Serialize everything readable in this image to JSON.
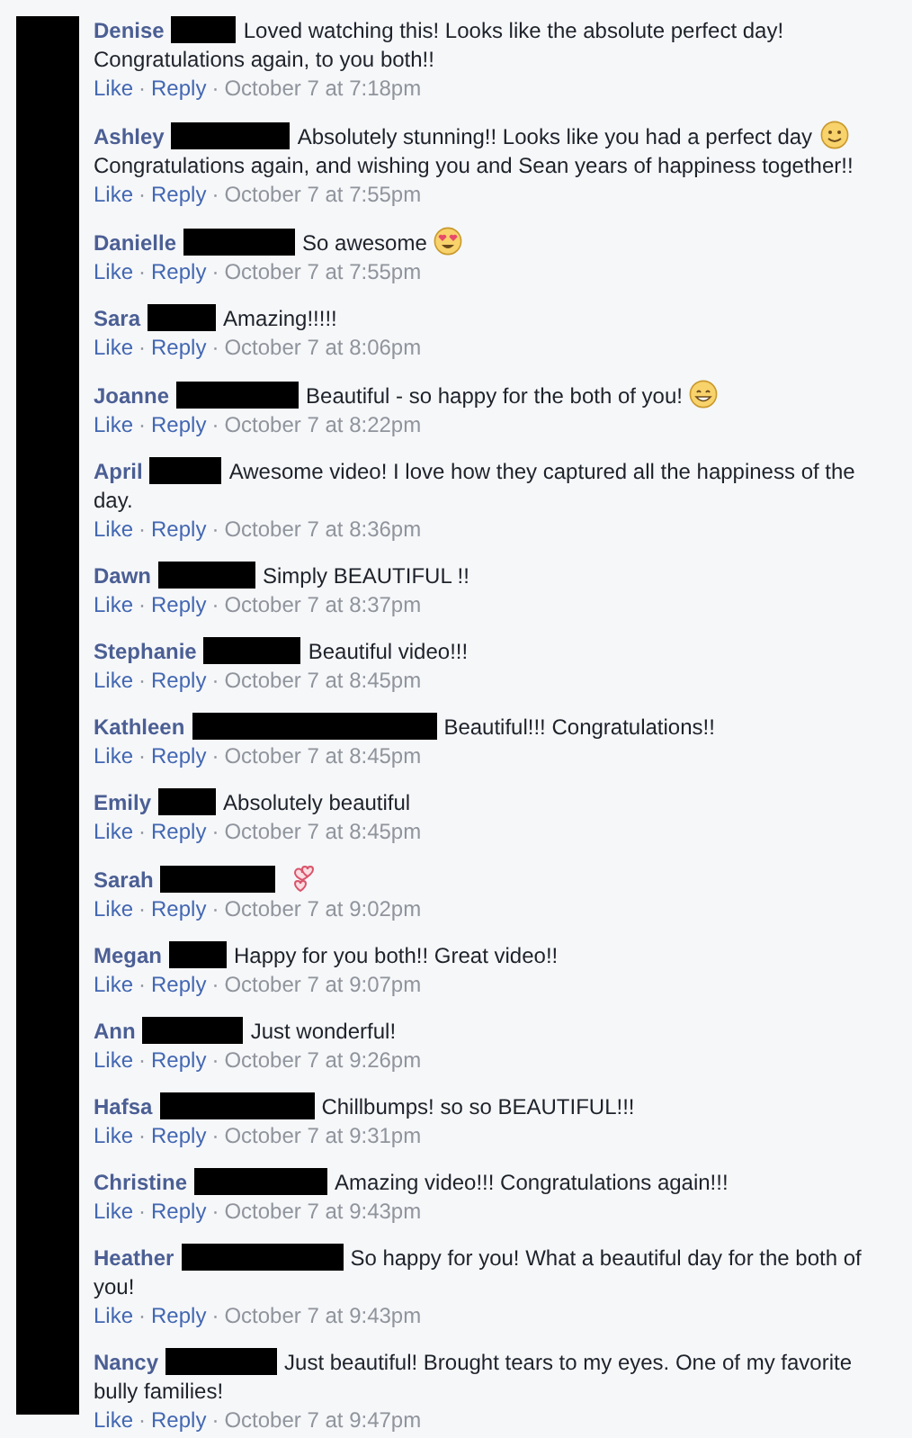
{
  "comments": [
    {
      "kind": "plain",
      "name": "Denise",
      "text": "Loved watching this! Looks like the absolute perfect day!",
      "text_after": "Congratulations again, to you both!!",
      "like": "Like",
      "dot_1": "·",
      "reply": "Reply",
      "dot_2": "·",
      "time": "October 7 at 7:18pm"
    },
    {
      "kind": "smile",
      "name": "Ashley",
      "text": "Absolutely stunning!! Looks like you had a perfect day",
      "text_after": "Congratulations again, and wishing you and Sean years of happiness together!!",
      "like": "Like",
      "dot_1": "·",
      "reply": "Reply",
      "dot_2": "·",
      "time": "October 7 at 7:55pm"
    },
    {
      "kind": "hearteyes",
      "name": "Danielle",
      "text": "So awesome",
      "like": "Like",
      "dot_1": "·",
      "reply": "Reply",
      "dot_2": "·",
      "time": "October 7 at 7:55pm"
    },
    {
      "kind": "plain",
      "name": "Sara",
      "text": "Amazing!!!!!",
      "like": "Like",
      "dot_1": "·",
      "reply": "Reply",
      "dot_2": "·",
      "time": "October 7 at 8:06pm"
    },
    {
      "kind": "grin",
      "name": "Joanne",
      "text": "Beautiful - so happy for the both of you!",
      "like": "Like",
      "dot_1": "·",
      "reply": "Reply",
      "dot_2": "·",
      "time": "October 7 at 8:22pm"
    },
    {
      "kind": "plain",
      "name": "April",
      "text": "Awesome video! I love how they captured all the happiness of the",
      "text_after": "day.",
      "like": "Like",
      "dot_1": "·",
      "reply": "Reply",
      "dot_2": "·",
      "time": "October 7 at 8:36pm"
    },
    {
      "kind": "plain",
      "name": "Dawn",
      "text": "Simply BEAUTIFUL !!",
      "like": "Like",
      "dot_1": "·",
      "reply": "Reply",
      "dot_2": "·",
      "time": "October 7 at 8:37pm"
    },
    {
      "kind": "plain",
      "name": "Stephanie",
      "text": "Beautiful video!!!",
      "like": "Like",
      "dot_1": "·",
      "reply": "Reply",
      "dot_2": "·",
      "time": "October 7 at 8:45pm"
    },
    {
      "kind": "plain",
      "name": "Kathleen",
      "text": "Beautiful!!! Congratulations!!",
      "like": "Like",
      "dot_1": "·",
      "reply": "Reply",
      "dot_2": "·",
      "time": "October 7 at 8:45pm"
    },
    {
      "kind": "plain",
      "name": "Emily",
      "text": "Absolutely beautiful",
      "like": "Like",
      "dot_1": "·",
      "reply": "Reply",
      "dot_2": "·",
      "time": "October 7 at 8:45pm"
    },
    {
      "kind": "hearts",
      "name": "Sarah",
      "like": "Like",
      "dot_1": "·",
      "reply": "Reply",
      "dot_2": "·",
      "time": "October 7 at 9:02pm"
    },
    {
      "kind": "plain",
      "name": "Megan",
      "text": "Happy for you both!! Great video!!",
      "like": "Like",
      "dot_1": "·",
      "reply": "Reply",
      "dot_2": "·",
      "time": "October 7 at 9:07pm"
    },
    {
      "kind": "plain",
      "name": "Ann",
      "text": "Just wonderful!",
      "like": "Like",
      "dot_1": "·",
      "reply": "Reply",
      "dot_2": "·",
      "time": "October 7 at 9:26pm"
    },
    {
      "kind": "plain",
      "name": "Hafsa",
      "text": "Chillbumps! so so BEAUTIFUL!!!",
      "like": "Like",
      "dot_1": "·",
      "reply": "Reply",
      "dot_2": "·",
      "time": "October 7 at 9:31pm"
    },
    {
      "kind": "plain",
      "name": "Christine",
      "text": "Amazing video!!! Congratulations again!!!",
      "like": "Like",
      "dot_1": "·",
      "reply": "Reply",
      "dot_2": "·",
      "time": "October 7 at 9:43pm"
    },
    {
      "kind": "plain",
      "name": "Heather",
      "text": "So happy for you! What a beautiful day for the both of",
      "text_after": "you!",
      "like": "Like",
      "dot_1": "·",
      "reply": "Reply",
      "dot_2": "·",
      "time": "October 7 at 9:43pm"
    },
    {
      "kind": "plain",
      "name": "Nancy",
      "text": "Just beautiful! Brought tears to my eyes. One of my favorite",
      "text_after": "bully families!",
      "like": "Like",
      "dot_1": "·",
      "reply": "Reply",
      "dot_2": "·",
      "time": "October 7 at 9:47pm"
    }
  ]
}
